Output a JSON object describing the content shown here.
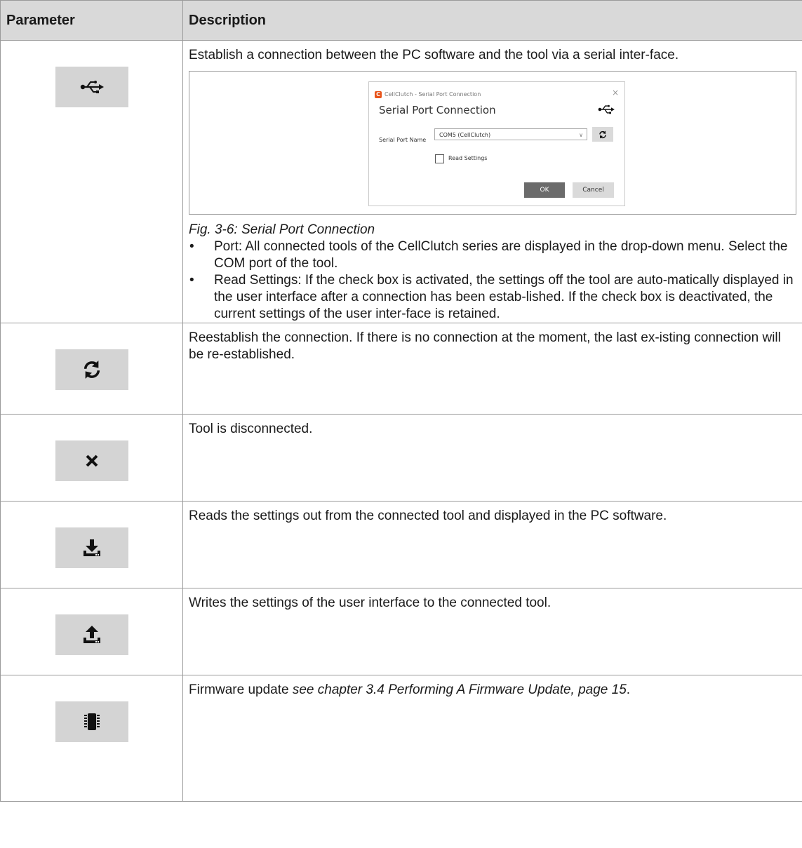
{
  "header": {
    "parameter": "Parameter",
    "description": "Description"
  },
  "rows": [
    {
      "icon": "usb-icon",
      "text": "Establish a connection between the PC software and the tool via a serial inter-face.",
      "figure": {
        "window_title": "CellClutch - Serial Port Connection",
        "heading": "Serial Port Connection",
        "port_label": "Serial Port Name",
        "port_value": "COM5 (CellClutch)",
        "checkbox_label": "Read Settings",
        "ok": "OK",
        "cancel": "Cancel"
      },
      "caption": "Fig. 3-6: Serial Port Connection",
      "bullets": [
        "Port: All connected tools of the CellClutch series are displayed in the drop-down menu. Select the COM port of the tool.",
        "Read Settings: If the check box is activated, the settings off the tool are auto-matically displayed in the user interface after a connection has been estab-lished. If the check box is deactivated, the current settings of the user inter-face is retained."
      ]
    },
    {
      "icon": "refresh-icon",
      "text": "Reestablish the connection. If there is no connection at the moment, the last ex-isting connection will be re-established."
    },
    {
      "icon": "close-icon",
      "text": "Tool is disconnected."
    },
    {
      "icon": "download-icon",
      "text": "Reads the settings out from the connected tool and displayed in the PC software."
    },
    {
      "icon": "upload-icon",
      "text": "Writes the settings of the user interface to the connected tool."
    },
    {
      "icon": "chip-icon",
      "text_prefix": "Firmware update ",
      "text_link": "see chapter 3.4 Performing A Firmware Update, page 15",
      "text_suffix": "."
    }
  ]
}
